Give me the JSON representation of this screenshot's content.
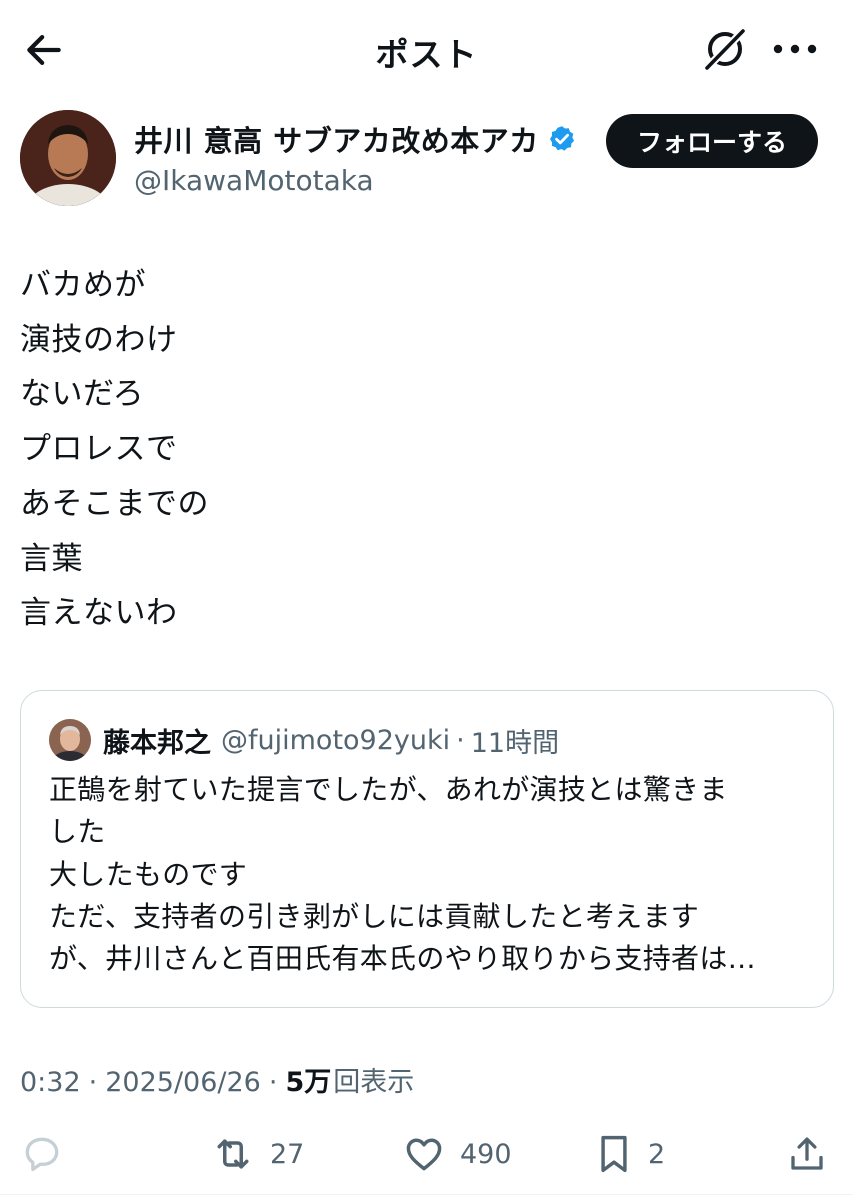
{
  "header": {
    "title": "ポスト",
    "back_icon": "arrow-left-icon",
    "grok_icon": "grok-icon",
    "more_icon": "more-horizontal-icon"
  },
  "author": {
    "name": "井川 意高 サブアカ改め本アカ",
    "handle": "@IkawaMototaka",
    "verified": true,
    "follow_label": "フォローする"
  },
  "tweet": {
    "lines": [
      "バカめが",
      "演技のわけ",
      "ないだろ",
      "プロレスで",
      "あそこまでの",
      "言葉",
      "言えないわ"
    ]
  },
  "quote": {
    "name": "藤本邦之",
    "handle": "@fujimoto92yuki",
    "separator": "·",
    "time": "11時間",
    "lines": [
      "正鵠を射ていた提言でしたが、あれが演技とは驚きま",
      "した",
      "大したものです",
      "ただ、支持者の引き剥がしには貢献したと考えます",
      "が、井川さんと百田氏有本氏のやり取りから支持者は…"
    ]
  },
  "meta": {
    "time": "0:32",
    "separator": "·",
    "date": "2025/06/26",
    "views_count": "5万",
    "views_label": "回表示"
  },
  "actions": {
    "reply_icon": "reply-icon",
    "retweet_icon": "retweet-icon",
    "retweet_count": "27",
    "like_icon": "heart-icon",
    "like_count": "490",
    "bookmark_icon": "bookmark-icon",
    "bookmark_count": "2",
    "share_icon": "share-icon"
  },
  "colors": {
    "text": "#0f1419",
    "secondary": "#536471",
    "verified": "#1d9bf0",
    "border": "#cfd9de",
    "follow_bg": "#0f1419"
  }
}
